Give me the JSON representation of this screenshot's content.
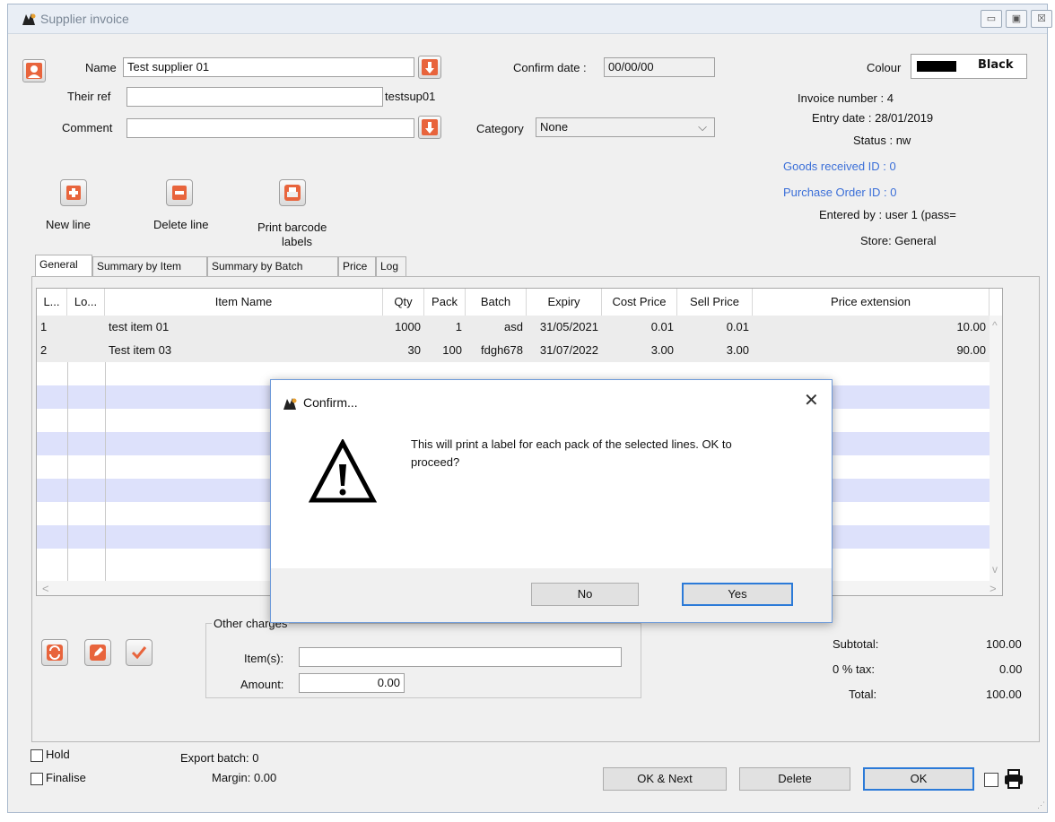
{
  "window": {
    "title": "Supplier invoice",
    "controls": {
      "minimize": "▭",
      "maximize": "▣",
      "close": "☒"
    }
  },
  "header": {
    "name_label": "Name",
    "name_value": "Test supplier 01",
    "their_ref_label": "Their ref",
    "their_ref_value": "",
    "supplier_code": "testsup01",
    "comment_label": "Comment",
    "comment_value": "",
    "confirm_date_label": "Confirm date :",
    "confirm_date_value": "00/00/00",
    "category_label": "Category",
    "category_value": "None",
    "colour_label": "Colour",
    "colour_value": "Black",
    "colour_swatch": "#000000"
  },
  "info": {
    "invoice_number": "Invoice number : 4",
    "entry_date": "Entry date : 28/01/2019",
    "status": "Status : nw",
    "goods_received": "Goods received ID : 0",
    "purchase_order": "Purchase Order ID : 0",
    "entered_by": "Entered by : user 1 (pass=",
    "store": "Store: General"
  },
  "toolbar": {
    "new_line": "New line",
    "delete_line": "Delete line",
    "print_barcode_1": "Print barcode",
    "print_barcode_2": "labels"
  },
  "tabs": [
    "General",
    "Summary by Item",
    "Summary by Batch",
    "Price",
    "Log"
  ],
  "table": {
    "headers": [
      "L...",
      "Lo...",
      "Item Name",
      "Qty",
      "Pack",
      "Batch",
      "Expiry",
      "Cost Price",
      "Sell Price",
      "Price extension"
    ],
    "rows": [
      {
        "line": "1",
        "loc": "",
        "name": "test item 01",
        "qty": "1000",
        "pack": "1",
        "batch": "asd",
        "expiry": "31/05/2021",
        "cost": "0.01",
        "sell": "0.01",
        "ext": "10.00"
      },
      {
        "line": "2",
        "loc": "",
        "name": "Test item 03",
        "qty": "30",
        "pack": "100",
        "batch": "fdgh678",
        "expiry": "31/07/2022",
        "cost": "3.00",
        "sell": "3.00",
        "ext": "90.00"
      }
    ]
  },
  "other_charges": {
    "legend": "Other charges",
    "items_label": "Item(s):",
    "items_value": "",
    "amount_label": "Amount:",
    "amount_value": "0.00"
  },
  "totals": {
    "subtotal_label": "Subtotal:",
    "subtotal": "100.00",
    "tax_label": "0 % tax:",
    "tax": "0.00",
    "total_label": "Total:",
    "total": "100.00"
  },
  "footer": {
    "hold": "Hold",
    "finalise": "Finalise",
    "export_batch": "Export batch: 0",
    "margin": "Margin: 0.00",
    "ok_next": "OK & Next",
    "delete": "Delete",
    "ok": "OK"
  },
  "dialog": {
    "title": "Confirm...",
    "message_1": "This will print a label for each pack of the selected lines. OK to",
    "message_2": "proceed?",
    "no": "No",
    "yes": "Yes",
    "close": "✕"
  },
  "colors": {
    "accent": "#2b7ad8",
    "stripe": "#dde1fb",
    "icon_orange": "#e8643c",
    "link_blue": "#3b6fd8"
  }
}
